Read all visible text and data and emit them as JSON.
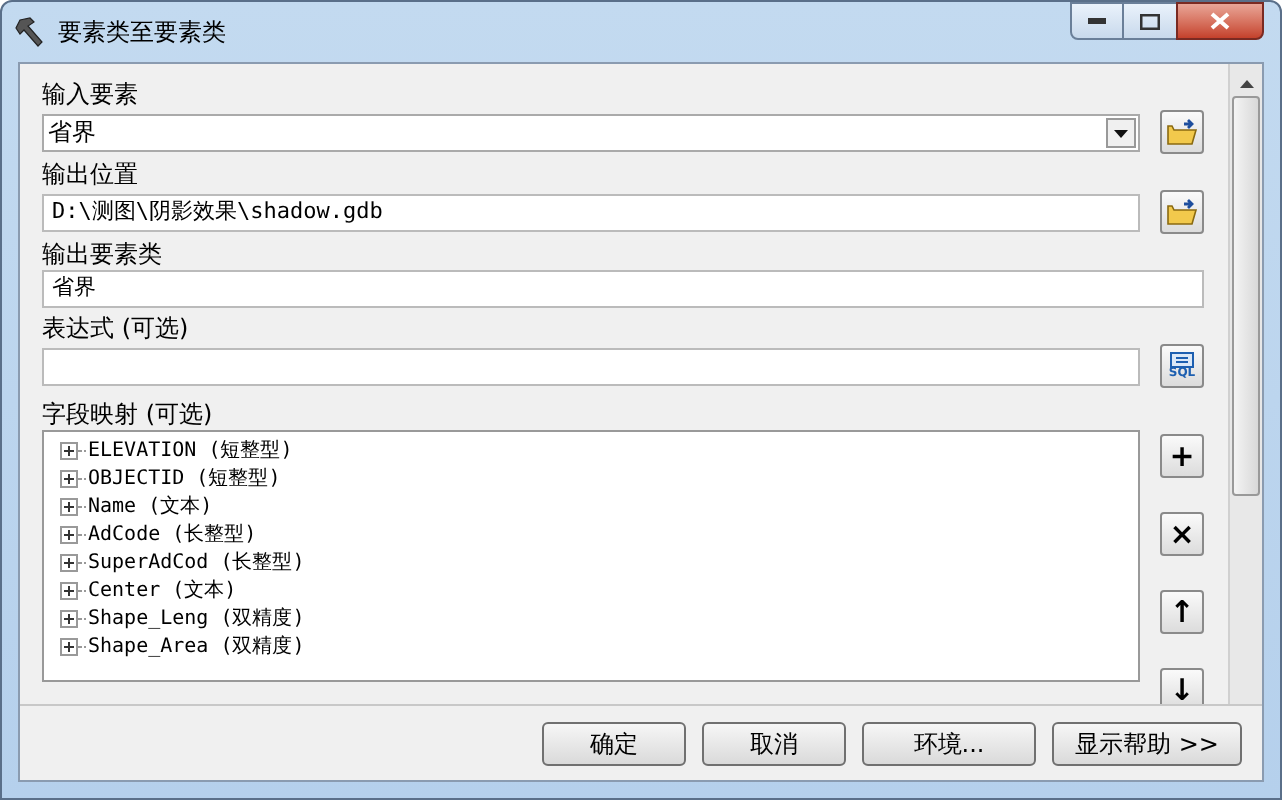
{
  "window": {
    "title": "要素类至要素类"
  },
  "fields": [
    {
      "kind": "dropdown",
      "label": "输入要素",
      "value": "省界",
      "browse": true,
      "sql": false
    },
    {
      "kind": "text",
      "label": "输出位置",
      "value": "D:\\测图\\阴影效果\\shadow.gdb",
      "browse": true,
      "sql": false
    },
    {
      "kind": "text",
      "label": "输出要素类",
      "value": "省界",
      "browse": false,
      "sql": false
    },
    {
      "kind": "text",
      "label": "表达式 (可选)",
      "browse": false,
      "sql": true
    }
  ],
  "sql_icon_text": "SQL",
  "field_map": {
    "label": "字段映射 (可选)",
    "items": [
      {
        "name": "ELEVATION",
        "type": "(短整型)",
        "expanded": false
      },
      {
        "name": "OBJECTID",
        "type": "(短整型)",
        "expanded": false
      },
      {
        "name": "Name",
        "type": "(文本)",
        "expanded": false
      },
      {
        "name": "AdCode",
        "type": "(长整型)",
        "expanded": false
      },
      {
        "name": "SuperAdCod",
        "type": "(长整型)",
        "expanded": false
      },
      {
        "name": "Center",
        "type": "(文本)",
        "expanded": false
      },
      {
        "name": "Shape_Leng",
        "type": "(双精度)",
        "expanded": false
      },
      {
        "name": "Shape_Area",
        "type": "(双精度)",
        "expanded": false
      }
    ],
    "tools": [
      "+",
      "×",
      "↑",
      "↓"
    ]
  },
  "buttons": [
    "确定",
    "取消",
    "环境...",
    "显示帮助 >>"
  ]
}
